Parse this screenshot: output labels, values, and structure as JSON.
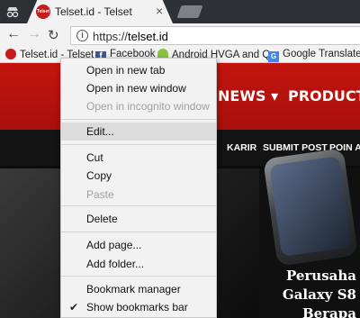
{
  "tab": {
    "title": "Telset.id - Telset",
    "favicon_text": "Telset",
    "close": "×"
  },
  "address_bar": {
    "scheme": "https://",
    "host": "telset.id"
  },
  "bookmarks": [
    {
      "label": "Telset.id - Telset",
      "icon": "telset-icon"
    },
    {
      "label": "Facebook",
      "icon": "facebook-icon"
    },
    {
      "label": "Android HVGA and Q",
      "icon": "android-icon"
    },
    {
      "label": "Google Translate",
      "icon": "translate-icon"
    }
  ],
  "site": {
    "nav": {
      "news": "NEWS ▾",
      "product": "PRODUCT ▾"
    },
    "subnav": [
      "KARIR",
      "SUBMIT POST",
      "POIN AN"
    ],
    "headline": [
      "Perusaha",
      "Galaxy S8",
      "Berapa"
    ]
  },
  "context_menu": {
    "items": [
      {
        "label": "Open in new tab",
        "enabled": true
      },
      {
        "label": "Open in new window",
        "enabled": true
      },
      {
        "label": "Open in incognito window",
        "enabled": false
      },
      {
        "label": "Edit...",
        "enabled": true,
        "highlighted": true
      },
      {
        "label": "Cut",
        "enabled": true
      },
      {
        "label": "Copy",
        "enabled": true
      },
      {
        "label": "Paste",
        "enabled": false
      },
      {
        "label": "Delete",
        "enabled": true
      },
      {
        "label": "Add page...",
        "enabled": true
      },
      {
        "label": "Add folder...",
        "enabled": true
      },
      {
        "label": "Bookmark manager",
        "enabled": true
      },
      {
        "label": "Show bookmarks bar",
        "enabled": true,
        "checked": true
      }
    ]
  },
  "colors": {
    "brand_red": "#c4140f",
    "menu_bg": "#f2f2f2",
    "menu_highlight": "#dcdcdc"
  }
}
